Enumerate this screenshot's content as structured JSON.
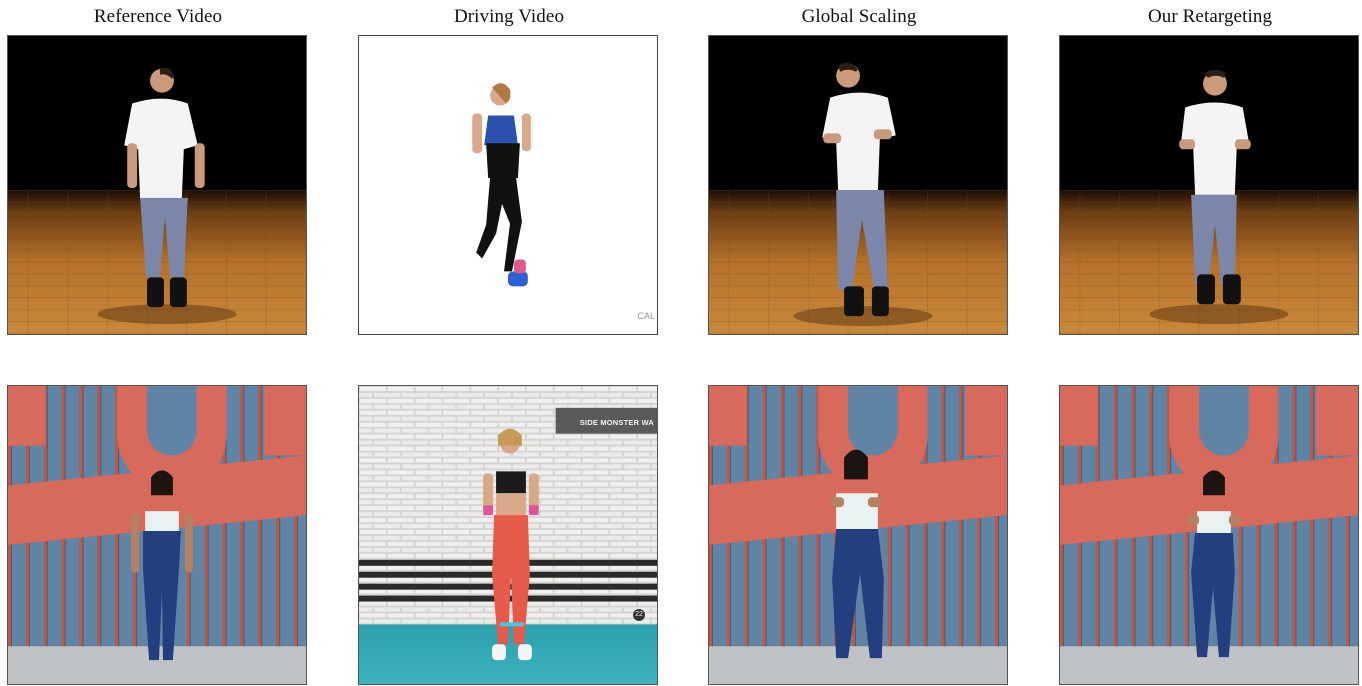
{
  "columns": [
    {
      "title": "Reference Video"
    },
    {
      "title": "Driving Video"
    },
    {
      "title": "Global Scaling"
    },
    {
      "title": "Our Retargeting"
    }
  ],
  "rows": [
    {
      "scene": "dance-studio-wood-floor"
    },
    {
      "scene": "red-letter-wall-street"
    }
  ],
  "overlays": {
    "driving_row1_watermark": "CAL",
    "driving_row2_banner": "SIDE MONSTER WA",
    "driving_row2_badge": "22"
  },
  "colors": {
    "studio_black": "#000000",
    "wood_floor": "#b5712a",
    "wall_blue": "#5b7fa0",
    "wall_red": "#d86a5c",
    "studio_white": "#ffffff",
    "brick_wall": "#dcdcdc",
    "gym_floor": "#2c9aa8"
  }
}
